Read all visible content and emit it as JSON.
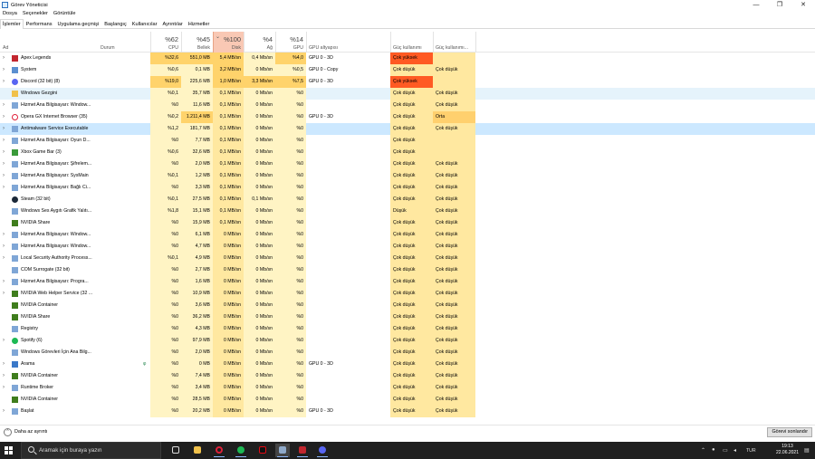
{
  "window": {
    "title": "Görev Yöneticisi",
    "controls": [
      "—",
      "❐",
      "✕"
    ]
  },
  "menu": [
    "Dosya",
    "Seçenekler",
    "Görüntüle"
  ],
  "tabs": [
    {
      "label": "İşlemler",
      "active": true
    },
    {
      "label": "Performans",
      "active": false
    },
    {
      "label": "Uygulama geçmişi",
      "active": false
    },
    {
      "label": "Başlangıç",
      "active": false
    },
    {
      "label": "Kullanıcılar",
      "active": false
    },
    {
      "label": "Ayrıntılar",
      "active": false
    },
    {
      "label": "Hizmetler",
      "active": false
    }
  ],
  "columns": {
    "name": "Ad",
    "status": "Durum",
    "cpu": {
      "pct": "%62",
      "label": "CPU"
    },
    "mem": {
      "pct": "%45",
      "label": "Bellek"
    },
    "disk": {
      "pct": "%100",
      "label": "Disk"
    },
    "net": {
      "pct": "%4",
      "label": "Ağ"
    },
    "gpu": {
      "pct": "%14",
      "label": "GPU"
    },
    "gpu_engine": "GPU altyapısı",
    "power": "Güç kullanımı",
    "power_trend": "Güç kullanımı..."
  },
  "colors": {
    "heat_low": "#fff4c4",
    "heat_mid": "#ffe8a0",
    "heat_high": "#ffd36b",
    "very_high": "#ff5a23",
    "medium": "#ffd06e",
    "sorted_header": "#f9c8b4",
    "sel_blue": "#cce8ff",
    "hover_blue": "#e5f3fb"
  },
  "rows": [
    {
      "name": "Apex Legends",
      "exp": true,
      "icon": "apex-icon",
      "cpu": "%32,6",
      "mem": "551,0 MB",
      "disk": "5,4 MB/sn",
      "net": "0,4 Mb/sn",
      "gpu": "%4,0",
      "engine": "GPU 0 - 3D",
      "power": "Çok yüksek",
      "trend": "",
      "powerLevel": "very_high",
      "trendLevel": "low"
    },
    {
      "name": "System",
      "exp": true,
      "icon": "system-icon",
      "cpu": "%0,6",
      "mem": "0,1 MB",
      "disk": "3,2 MB/sn",
      "net": "0 Mb/sn",
      "gpu": "%0,5",
      "engine": "GPU 0 - Copy",
      "power": "Çok düşük",
      "trend": "Çok düşük",
      "powerLevel": "low",
      "trendLevel": "low"
    },
    {
      "name": "Discord (32 bit) (8)",
      "exp": true,
      "icon": "discord-icon",
      "cpu": "%19,0",
      "mem": "225,6 MB",
      "disk": "1,0 MB/sn",
      "net": "3,3 Mb/sn",
      "gpu": "%7,5",
      "engine": "GPU 0 - 3D",
      "power": "Çok yüksek",
      "trend": "",
      "powerLevel": "very_high",
      "trendLevel": "low"
    },
    {
      "name": "Windows Gezgini",
      "exp": false,
      "icon": "explorer-icon",
      "cpu": "%0,1",
      "mem": "35,7 MB",
      "disk": "0,1 MB/sn",
      "net": "0 Mb/sn",
      "gpu": "%0",
      "engine": "",
      "power": "Çok düşük",
      "trend": "Çok düşük",
      "powerLevel": "low",
      "trendLevel": "low",
      "hl": "hl-light"
    },
    {
      "name": "Hizmet Ana Bilgisayarı: Window...",
      "exp": true,
      "icon": "service-icon",
      "cpu": "%0",
      "mem": "11,6 MB",
      "disk": "0,1 MB/sn",
      "net": "0 Mb/sn",
      "gpu": "%0",
      "engine": "",
      "power": "Çok düşük",
      "trend": "Çok düşük",
      "powerLevel": "low",
      "trendLevel": "low"
    },
    {
      "name": "Opera GX Internet Browser (35)",
      "exp": true,
      "icon": "opera-icon",
      "cpu": "%0,2",
      "mem": "1.211,4 MB",
      "disk": "0,1 MB/sn",
      "net": "0 Mb/sn",
      "gpu": "%0",
      "engine": "GPU 0 - 3D",
      "power": "Çok düşük",
      "trend": "Orta",
      "powerLevel": "low",
      "trendLevel": "medium"
    },
    {
      "name": "Antimalware Service Executable",
      "exp": true,
      "icon": "service-icon",
      "cpu": "%1,2",
      "mem": "181,7 MB",
      "disk": "0,1 MB/sn",
      "net": "0 Mb/sn",
      "gpu": "%0",
      "engine": "",
      "power": "Çok düşük",
      "trend": "Çok düşük",
      "powerLevel": "low",
      "trendLevel": "low",
      "hl": "hl-blue"
    },
    {
      "name": "Hizmet Ana Bilgisayarı: Oyun D...",
      "exp": true,
      "icon": "service-icon",
      "cpu": "%0",
      "mem": "7,7 MB",
      "disk": "0,1 MB/sn",
      "net": "0 Mb/sn",
      "gpu": "%0",
      "engine": "",
      "power": "Çok düşük",
      "trend": "",
      "powerLevel": "low",
      "trendLevel": "low"
    },
    {
      "name": "Xbox Game Bar (3)",
      "exp": true,
      "icon": "xbox-icon",
      "cpu": "%0,6",
      "mem": "32,6 MB",
      "disk": "0,1 MB/sn",
      "net": "0 Mb/sn",
      "gpu": "%0",
      "engine": "",
      "power": "Çok düşük",
      "trend": "",
      "powerLevel": "low",
      "trendLevel": "low"
    },
    {
      "name": "Hizmet Ana Bilgisayarı: Şifrelem...",
      "exp": true,
      "icon": "service-icon",
      "cpu": "%0",
      "mem": "2,0 MB",
      "disk": "0,1 MB/sn",
      "net": "0 Mb/sn",
      "gpu": "%0",
      "engine": "",
      "power": "Çok düşük",
      "trend": "Çok düşük",
      "powerLevel": "low",
      "trendLevel": "low"
    },
    {
      "name": "Hizmet Ana Bilgisayarı: SysMain",
      "exp": true,
      "icon": "service-icon",
      "cpu": "%0,1",
      "mem": "1,2 MB",
      "disk": "0,1 MB/sn",
      "net": "0 Mb/sn",
      "gpu": "%0",
      "engine": "",
      "power": "Çok düşük",
      "trend": "Çok düşük",
      "powerLevel": "low",
      "trendLevel": "low"
    },
    {
      "name": "Hizmet Ana Bilgisayarı: Bağlı Ci...",
      "exp": true,
      "icon": "service-icon",
      "cpu": "%0",
      "mem": "3,3 MB",
      "disk": "0,1 MB/sn",
      "net": "0 Mb/sn",
      "gpu": "%0",
      "engine": "",
      "power": "Çok düşük",
      "trend": "Çok düşük",
      "powerLevel": "low",
      "trendLevel": "low"
    },
    {
      "name": "Steam (32 bit)",
      "exp": false,
      "icon": "steam-icon",
      "cpu": "%0,1",
      "mem": "27,5 MB",
      "disk": "0,1 MB/sn",
      "net": "0,1 Mb/sn",
      "gpu": "%0",
      "engine": "",
      "power": "Çok düşük",
      "trend": "Çok düşük",
      "powerLevel": "low",
      "trendLevel": "low"
    },
    {
      "name": "Windows Ses Aygıtı Grafik Yalıtı...",
      "exp": false,
      "icon": "service-icon",
      "cpu": "%1,8",
      "mem": "15,1 MB",
      "disk": "0,1 MB/sn",
      "net": "0 Mb/sn",
      "gpu": "%0",
      "engine": "",
      "power": "Düşük",
      "trend": "Çok düşük",
      "powerLevel": "low",
      "trendLevel": "low"
    },
    {
      "name": "NVIDIA Share",
      "exp": false,
      "icon": "nvidia-icon",
      "cpu": "%0",
      "mem": "15,9 MB",
      "disk": "0,1 MB/sn",
      "net": "0 Mb/sn",
      "gpu": "%0",
      "engine": "",
      "power": "Çok düşük",
      "trend": "Çok düşük",
      "powerLevel": "low",
      "trendLevel": "low"
    },
    {
      "name": "Hizmet Ana Bilgisayarı: Window...",
      "exp": true,
      "icon": "service-icon",
      "cpu": "%0",
      "mem": "6,1 MB",
      "disk": "0 MB/sn",
      "net": "0 Mb/sn",
      "gpu": "%0",
      "engine": "",
      "power": "Çok düşük",
      "trend": "Çok düşük",
      "powerLevel": "low",
      "trendLevel": "low"
    },
    {
      "name": "Hizmet Ana Bilgisayarı: Window...",
      "exp": true,
      "icon": "service-icon",
      "cpu": "%0",
      "mem": "4,7 MB",
      "disk": "0 MB/sn",
      "net": "0 Mb/sn",
      "gpu": "%0",
      "engine": "",
      "power": "Çok düşük",
      "trend": "Çok düşük",
      "powerLevel": "low",
      "trendLevel": "low"
    },
    {
      "name": "Local Security Authority Process...",
      "exp": true,
      "icon": "service-icon",
      "cpu": "%0,1",
      "mem": "4,9 MB",
      "disk": "0 MB/sn",
      "net": "0 Mb/sn",
      "gpu": "%0",
      "engine": "",
      "power": "Çok düşük",
      "trend": "Çok düşük",
      "powerLevel": "low",
      "trendLevel": "low"
    },
    {
      "name": "COM Surrogate (32 bit)",
      "exp": false,
      "icon": "service-icon",
      "cpu": "%0",
      "mem": "2,7 MB",
      "disk": "0 MB/sn",
      "net": "0 Mb/sn",
      "gpu": "%0",
      "engine": "",
      "power": "Çok düşük",
      "trend": "Çok düşük",
      "powerLevel": "low",
      "trendLevel": "low"
    },
    {
      "name": "Hizmet Ana Bilgisayarı: Progra...",
      "exp": true,
      "icon": "service-icon",
      "cpu": "%0",
      "mem": "1,6 MB",
      "disk": "0 MB/sn",
      "net": "0 Mb/sn",
      "gpu": "%0",
      "engine": "",
      "power": "Çok düşük",
      "trend": "Çok düşük",
      "powerLevel": "low",
      "trendLevel": "low"
    },
    {
      "name": "NVIDIA Web Helper Service (32 ...",
      "exp": true,
      "icon": "nvidia-icon",
      "cpu": "%0",
      "mem": "10,9 MB",
      "disk": "0 MB/sn",
      "net": "0 Mb/sn",
      "gpu": "%0",
      "engine": "",
      "power": "Çok düşük",
      "trend": "Çok düşük",
      "powerLevel": "low",
      "trendLevel": "low"
    },
    {
      "name": "NVIDIA Container",
      "exp": false,
      "icon": "nvidia-icon",
      "cpu": "%0",
      "mem": "3,6 MB",
      "disk": "0 MB/sn",
      "net": "0 Mb/sn",
      "gpu": "%0",
      "engine": "",
      "power": "Çok düşük",
      "trend": "Çok düşük",
      "powerLevel": "low",
      "trendLevel": "low"
    },
    {
      "name": "NVIDIA Share",
      "exp": false,
      "icon": "nvidia-icon",
      "cpu": "%0",
      "mem": "36,2 MB",
      "disk": "0 MB/sn",
      "net": "0 Mb/sn",
      "gpu": "%0",
      "engine": "",
      "power": "Çok düşük",
      "trend": "Çok düşük",
      "powerLevel": "low",
      "trendLevel": "low"
    },
    {
      "name": "Registry",
      "exp": false,
      "icon": "service-icon",
      "cpu": "%0",
      "mem": "4,3 MB",
      "disk": "0 MB/sn",
      "net": "0 Mb/sn",
      "gpu": "%0",
      "engine": "",
      "power": "Çok düşük",
      "trend": "Çok düşük",
      "powerLevel": "low",
      "trendLevel": "low"
    },
    {
      "name": "Spotify (6)",
      "exp": true,
      "icon": "spotify-icon",
      "cpu": "%0",
      "mem": "97,9 MB",
      "disk": "0 MB/sn",
      "net": "0 Mb/sn",
      "gpu": "%0",
      "engine": "",
      "power": "Çok düşük",
      "trend": "Çok düşük",
      "powerLevel": "low",
      "trendLevel": "low"
    },
    {
      "name": "Windows Görevleri İçin Ana Bilg...",
      "exp": false,
      "icon": "service-icon",
      "cpu": "%0",
      "mem": "2,0 MB",
      "disk": "0 MB/sn",
      "net": "0 Mb/sn",
      "gpu": "%0",
      "engine": "",
      "power": "Çok düşük",
      "trend": "Çok düşük",
      "powerLevel": "low",
      "trendLevel": "low"
    },
    {
      "name": "Arama",
      "exp": true,
      "icon": "search-app-icon",
      "status": "φ",
      "cpu": "%0",
      "mem": "0 MB",
      "disk": "0 MB/sn",
      "net": "0 Mb/sn",
      "gpu": "%0",
      "engine": "GPU 0 - 3D",
      "power": "Çok düşük",
      "trend": "Çok düşük",
      "powerLevel": "low",
      "trendLevel": "low"
    },
    {
      "name": "NVIDIA Container",
      "exp": true,
      "icon": "nvidia-icon",
      "cpu": "%0",
      "mem": "7,4 MB",
      "disk": "0 MB/sn",
      "net": "0 Mb/sn",
      "gpu": "%0",
      "engine": "",
      "power": "Çok düşük",
      "trend": "Çok düşük",
      "powerLevel": "low",
      "trendLevel": "low"
    },
    {
      "name": "Runtime Broker",
      "exp": true,
      "icon": "service-icon",
      "cpu": "%0",
      "mem": "3,4 MB",
      "disk": "0 MB/sn",
      "net": "0 Mb/sn",
      "gpu": "%0",
      "engine": "",
      "power": "Çok düşük",
      "trend": "Çok düşük",
      "powerLevel": "low",
      "trendLevel": "low"
    },
    {
      "name": "NVIDIA Container",
      "exp": false,
      "icon": "nvidia-icon",
      "cpu": "%0",
      "mem": "28,5 MB",
      "disk": "0 MB/sn",
      "net": "0 Mb/sn",
      "gpu": "%0",
      "engine": "",
      "power": "Çok düşük",
      "trend": "Çok düşük",
      "powerLevel": "low",
      "trendLevel": "low"
    },
    {
      "name": "Başlat",
      "exp": true,
      "icon": "service-icon",
      "cpu": "%0",
      "mem": "20,2 MB",
      "disk": "0 MB/sn",
      "net": "0 Mb/sn",
      "gpu": "%0",
      "engine": "GPU 0 - 3D",
      "power": "Çok düşük",
      "trend": "Çok düşük",
      "powerLevel": "low",
      "trendLevel": "low"
    }
  ],
  "footer": {
    "less_details": "Daha az ayrıntı",
    "end_task": "Görevi sonlandır"
  },
  "taskbar": {
    "search_placeholder": "Aramak için buraya yazın",
    "language": "TUR",
    "time": "19:13",
    "date": "22.06.2021",
    "tray_icons": [
      "chevron-up-icon",
      "discord-tray-icon",
      "network-icon",
      "volume-icon"
    ]
  }
}
